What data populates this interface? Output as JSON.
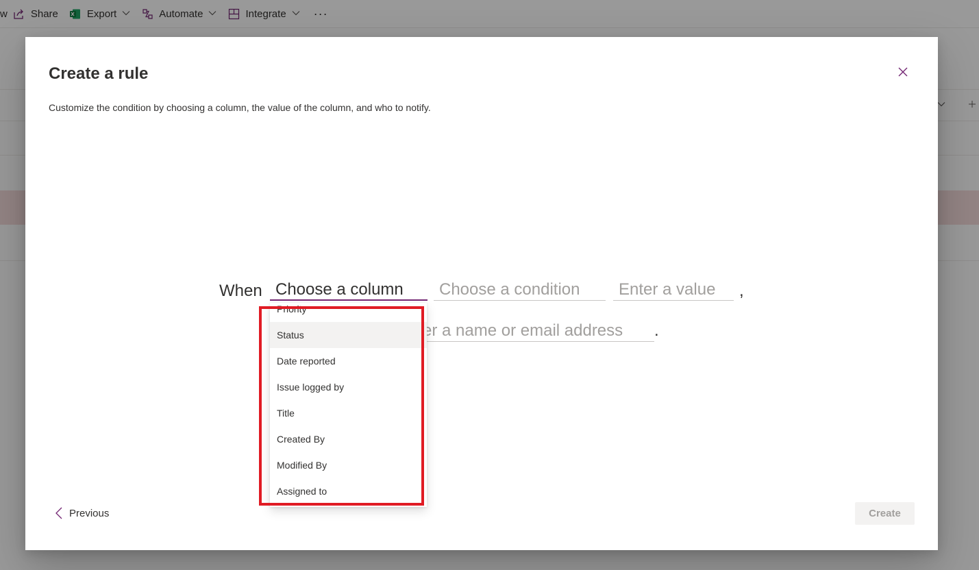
{
  "commandbar": {
    "partial_item": "w",
    "items": [
      {
        "label": "Share",
        "icon": "share-icon",
        "has_chevron": false
      },
      {
        "label": "Export",
        "icon": "excel-icon",
        "has_chevron": true
      },
      {
        "label": "Automate",
        "icon": "automate-icon",
        "has_chevron": true
      },
      {
        "label": "Integrate",
        "icon": "integrate-icon",
        "has_chevron": true
      }
    ],
    "more_label": "···"
  },
  "dialog": {
    "title": "Create a rule",
    "subtitle": "Customize the condition by choosing a column, the value of the column, and who to notify.",
    "rule": {
      "when_label": "When",
      "column_field": "Choose a column",
      "condition_placeholder": "Choose a condition",
      "value_placeholder": "Enter a value",
      "comma": ",",
      "person_placeholder": "nter a name or email address",
      "period": "."
    },
    "dropdown": {
      "items": [
        "Priority",
        "Status",
        "Date reported",
        "Issue logged by",
        "Title",
        "Created By",
        "Modified By",
        "Assigned to"
      ],
      "hovered": "Status"
    },
    "footer": {
      "previous_label": "Previous",
      "create_label": "Create"
    }
  },
  "colors": {
    "accent": "#742774",
    "highlight": "#e01b24",
    "overlay": "rgba(0,0,0,0.40)"
  }
}
